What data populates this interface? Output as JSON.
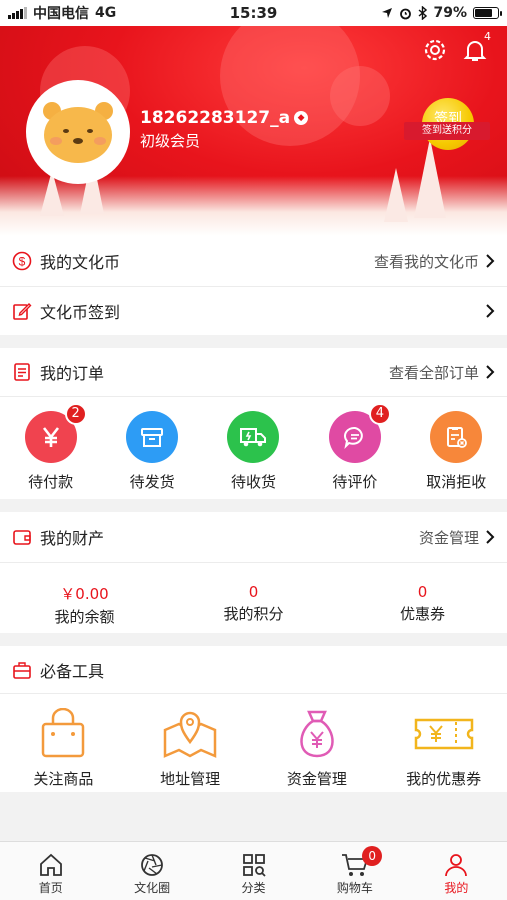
{
  "status_bar": {
    "carrier": "中国电信",
    "network": "4G",
    "time": "15:39",
    "battery": "79%",
    "battery_level": 0.79
  },
  "header": {
    "username": "18262283127_a",
    "level": "初级会员",
    "bell_count": "4",
    "sign_button": "签到",
    "sign_ribbon": "签到送积分"
  },
  "coins": {
    "title": "我的文化币",
    "more": "查看我的文化币"
  },
  "checkin": {
    "title": "文化币签到"
  },
  "orders": {
    "title": "我的订单",
    "more": "查看全部订单",
    "items": [
      {
        "label": "待付款",
        "badge": "2",
        "icon": "yen-icon",
        "color": "#f0434f"
      },
      {
        "label": "待发货",
        "badge": "",
        "icon": "box-icon",
        "color": "#2d9cf5"
      },
      {
        "label": "待收货",
        "badge": "",
        "icon": "truck-icon",
        "color": "#2cc24c"
      },
      {
        "label": "待评价",
        "badge": "4",
        "icon": "comment-icon",
        "color": "#e04aa3"
      },
      {
        "label": "取消拒收",
        "badge": "",
        "icon": "cancel-icon",
        "color": "#f7873a"
      }
    ]
  },
  "assets": {
    "title": "我的财产",
    "more": "资金管理",
    "items": [
      {
        "value": "￥0.00",
        "label": "我的余额"
      },
      {
        "value": "0",
        "label": "我的积分"
      },
      {
        "value": "0",
        "label": "优惠券"
      }
    ]
  },
  "tools": {
    "title": "必备工具",
    "items": [
      {
        "label": "关注商品",
        "icon": "bag-icon"
      },
      {
        "label": "地址管理",
        "icon": "map-pin-icon"
      },
      {
        "label": "资金管理",
        "icon": "money-bag-icon"
      },
      {
        "label": "我的优惠券",
        "icon": "coupon-icon"
      }
    ]
  },
  "tabbar": {
    "items": [
      {
        "label": "首页",
        "icon": "home-icon"
      },
      {
        "label": "文化圈",
        "icon": "aperture-icon"
      },
      {
        "label": "分类",
        "icon": "category-icon"
      },
      {
        "label": "购物车",
        "icon": "cart-icon"
      },
      {
        "label": "我的",
        "icon": "user-icon"
      }
    ],
    "cart_badge": "0",
    "active": "我的"
  },
  "colors": {
    "brand_red": "#e8141c",
    "badge_red": "#e02020"
  }
}
